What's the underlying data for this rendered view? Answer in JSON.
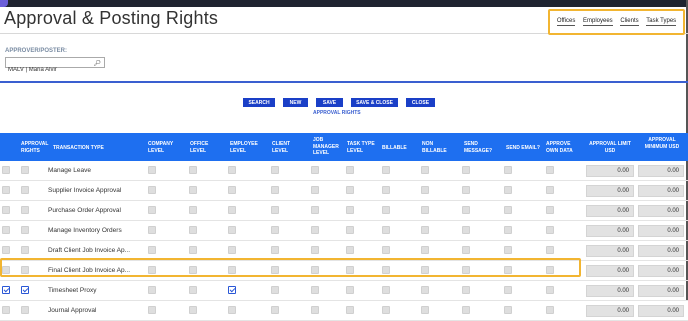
{
  "page": {
    "title": "Approval & Posting Rights"
  },
  "top_links": [
    "Offices",
    "Employees",
    "Clients",
    "Task Types"
  ],
  "approver": {
    "label": "APPROVER/POSTER:",
    "value": "MALV | Maria Alvir"
  },
  "buttons": [
    "SEARCH",
    "NEW",
    "SAVE",
    "SAVE & CLOSE",
    "CLOSE"
  ],
  "subtitle": "APPROVAL RIGHTS",
  "columns": [
    "APPROVAL RIGHTS",
    "TRANSACTION TYPE",
    "COMPANY LEVEL",
    "OFFICE LEVEL",
    "EMPLOYEE LEVEL",
    "CLIENT LEVEL",
    "JOB MANAGER LEVEL",
    "TASK TYPE LEVEL",
    "BILLABLE",
    "NON BILLABLE",
    "SEND MESSAGE?",
    "SEND EMAIL?",
    "APPROVE OWN DATA",
    "APPROVAL LIMIT USD",
    "APPROVAL MINIMUM USD"
  ],
  "rows": [
    {
      "type": "Manage Leave",
      "select": false,
      "rights": false,
      "employee_level": false,
      "limit": "0.00",
      "minimum": "0.00"
    },
    {
      "type": "Supplier Invoice Approval",
      "select": false,
      "rights": false,
      "employee_level": false,
      "limit": "0.00",
      "minimum": "0.00"
    },
    {
      "type": "Purchase Order Approval",
      "select": false,
      "rights": false,
      "employee_level": false,
      "limit": "0.00",
      "minimum": "0.00"
    },
    {
      "type": "Manage Inventory Orders",
      "select": false,
      "rights": false,
      "employee_level": false,
      "limit": "0.00",
      "minimum": "0.00"
    },
    {
      "type": "Draft Client Job Invoice Ap...",
      "select": false,
      "rights": false,
      "employee_level": false,
      "limit": "0.00",
      "minimum": "0.00"
    },
    {
      "type": "Final Client Job Invoice Ap...",
      "select": false,
      "rights": false,
      "employee_level": false,
      "limit": "0.00",
      "minimum": "0.00"
    },
    {
      "type": "Timesheet Proxy",
      "select": true,
      "rights": true,
      "employee_level": true,
      "limit": "0.00",
      "minimum": "0.00"
    },
    {
      "type": "Journal Approval",
      "select": false,
      "rights": false,
      "employee_level": false,
      "limit": "0.00",
      "minimum": "0.00"
    }
  ],
  "colors": {
    "accent": "#1e6ff0",
    "button": "#1a3fc7",
    "highlight": "#f2b531",
    "title_bar": "#1f2430"
  }
}
